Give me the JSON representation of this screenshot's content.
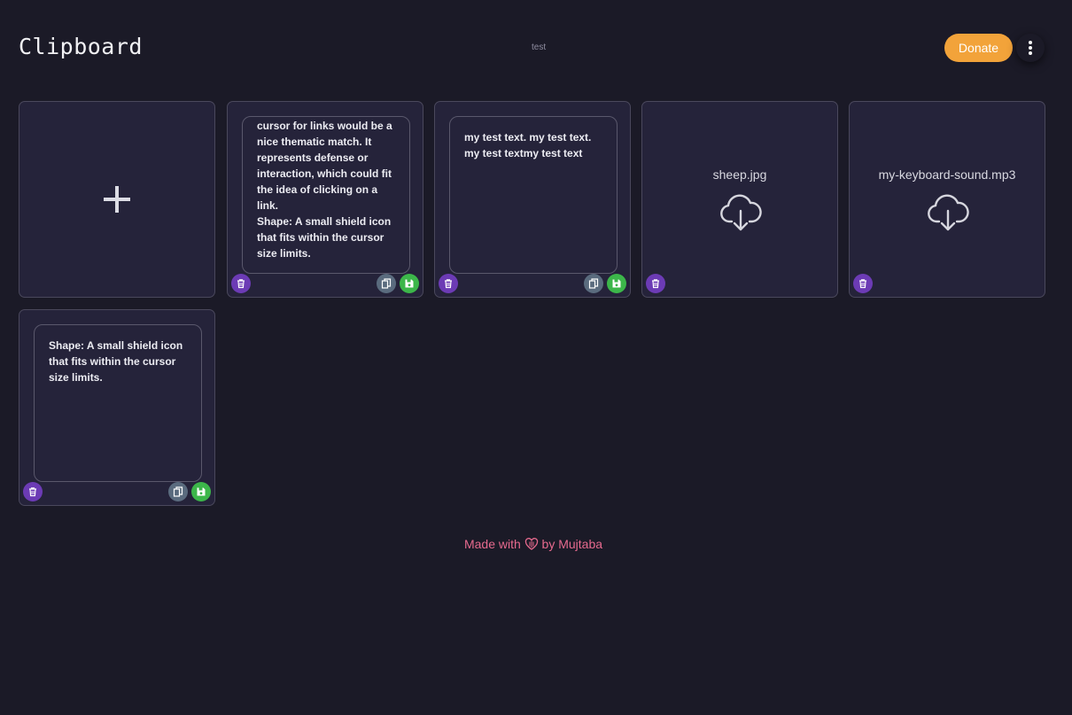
{
  "header": {
    "title": "Clipboard",
    "subtitle": "test",
    "donate_label": "Donate",
    "menu_icon": "more-vertical-icon"
  },
  "cards": [
    {
      "type": "add",
      "icon": "plus-icon"
    },
    {
      "type": "text",
      "text": "cursor for links would be a nice thematic match. It represents defense or interaction, which could fit the idea of clicking on a link.\nShape: A small shield icon that fits within the cursor size limits."
    },
    {
      "type": "text",
      "text": "my test text. my test text. my test textmy test text"
    },
    {
      "type": "file",
      "name": "sheep.jpg",
      "icon": "cloud-download-icon"
    },
    {
      "type": "file",
      "name": "my-keyboard-sound.mp3",
      "icon": "cloud-download-icon"
    },
    {
      "type": "text",
      "text": "Shape: A small shield icon that fits within the cursor size limits."
    }
  ],
  "footer": {
    "made_with": "Made with",
    "by": "by",
    "author": "Mujtaba"
  },
  "colors": {
    "background": "#1b1a27",
    "card": "#25233a",
    "donate": "#f2a33a",
    "delete": "#6c3bb5",
    "copy": "#5a6b7e",
    "save": "#3cb64a",
    "footer": "#e66a8e"
  }
}
